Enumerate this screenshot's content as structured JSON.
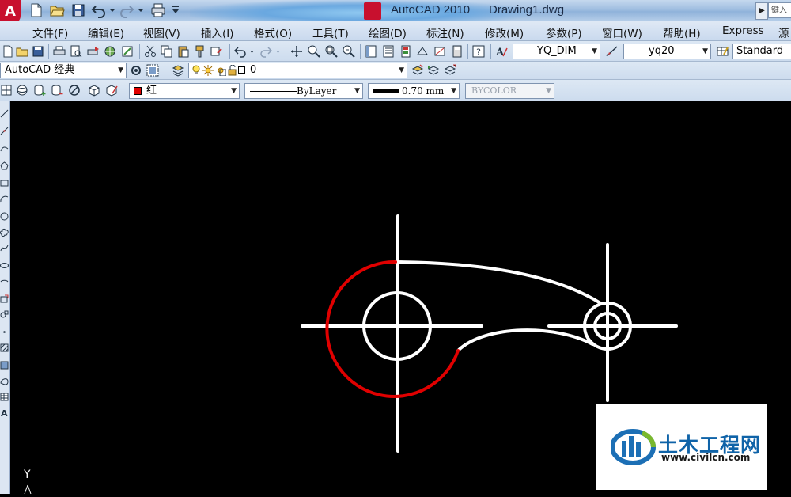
{
  "window": {
    "app_name": "AutoCAD 2010",
    "file_name": "Drawing1.dwg",
    "logo_letter": "A",
    "search_placeholder": "键入"
  },
  "menu": {
    "items": [
      "文件(F)",
      "编辑(E)",
      "视图(V)",
      "插入(I)",
      "格式(O)",
      "工具(T)",
      "绘图(D)",
      "标注(N)",
      "修改(M)",
      "参数(P)",
      "窗口(W)",
      "帮助(H)",
      "Express",
      "源"
    ]
  },
  "toolbar": {
    "dim_style": "YQ_DIM",
    "text_style": "yq20",
    "table_style": "Standard",
    "workspace": "AutoCAD 经典",
    "layer": "0"
  },
  "properties": {
    "color": "红",
    "color_swatch": "#e00000",
    "linetype": "ByLayer",
    "lineweight": "0.70 mm",
    "plotstyle": "BYCOLOR"
  },
  "canvas": {
    "ucs_label": "Y",
    "background": "#000000",
    "line_color": "#ffffff",
    "highlight_color": "#e00000"
  },
  "watermark": {
    "title": "土木工程网",
    "url": "www.civilcn.com"
  }
}
